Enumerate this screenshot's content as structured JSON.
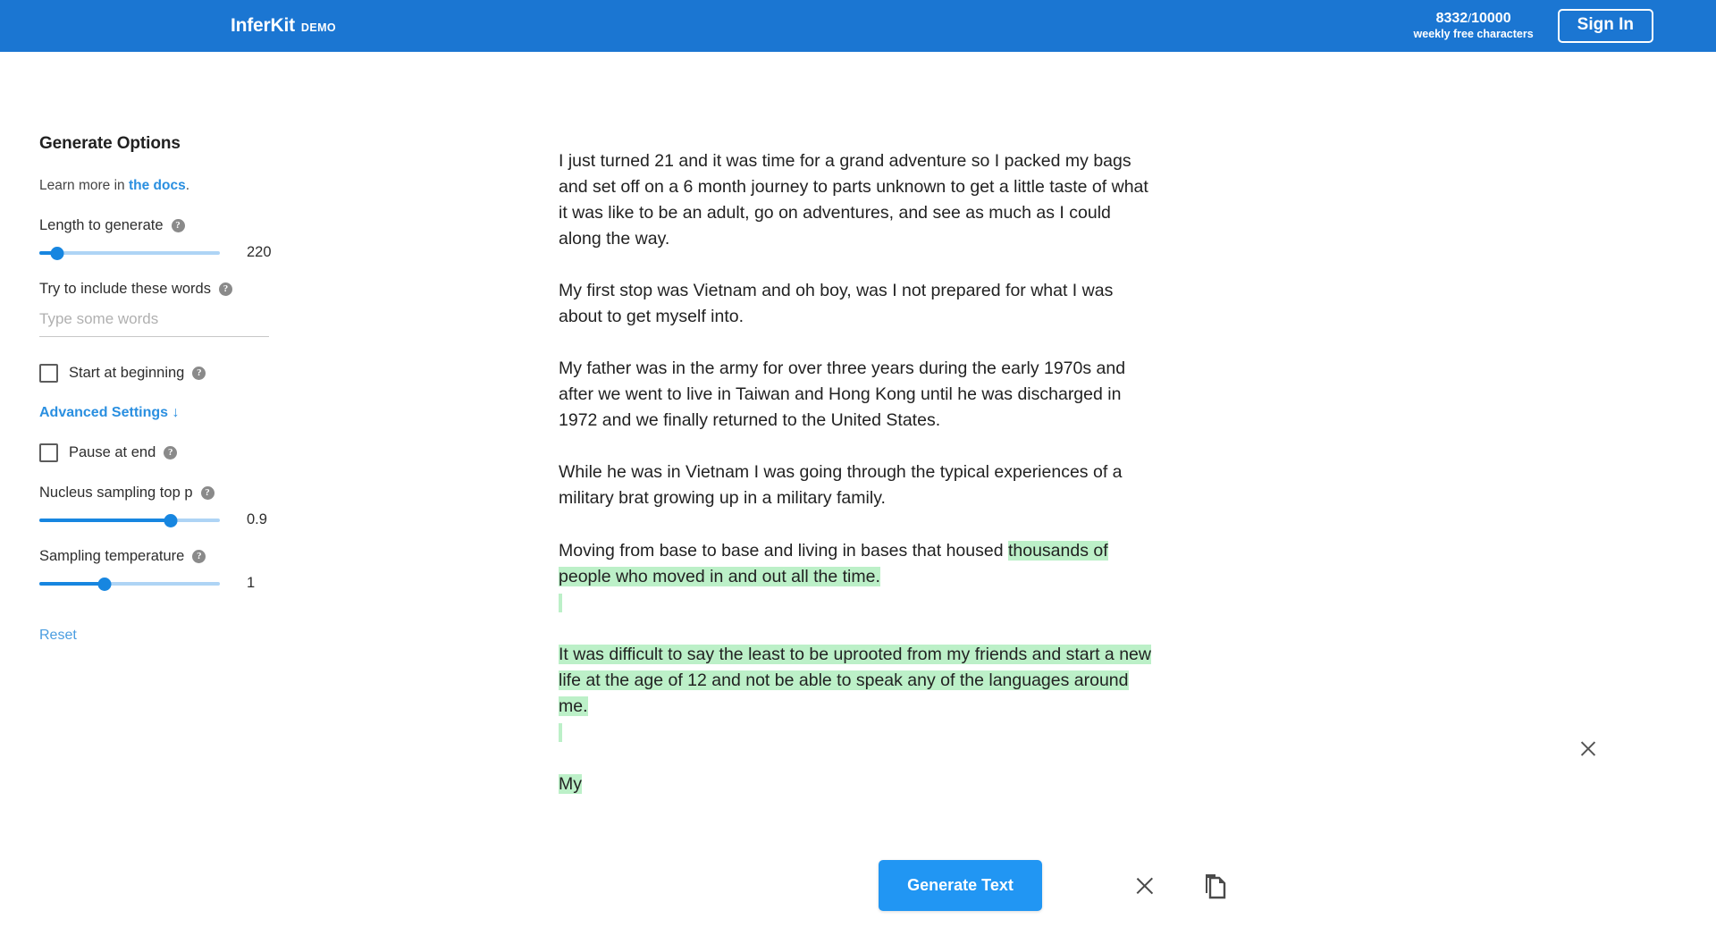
{
  "header": {
    "logo_main": "InferKit",
    "logo_sub": "DEMO",
    "quota_used": "8332",
    "quota_separator": "/",
    "quota_total": "10000",
    "quota_caption": "weekly free characters",
    "signin_label": "Sign In",
    "brand_color": "#1b76d2"
  },
  "sidebar": {
    "title": "Generate Options",
    "learn_more_prefix": "Learn more in ",
    "learn_more_link": "the docs",
    "learn_more_suffix": ".",
    "length": {
      "label": "Length to generate",
      "value": "220",
      "percent": 10
    },
    "include_words": {
      "label": "Try to include these words",
      "value": "",
      "placeholder": "Type some words"
    },
    "start_at_beginning": {
      "label": "Start at beginning",
      "checked": false
    },
    "advanced_settings": {
      "label": "Advanced Settings",
      "arrow": "↓"
    },
    "pause_at_end": {
      "label": "Pause at end",
      "checked": false
    },
    "top_p": {
      "label": "Nucleus sampling top p",
      "value": "0.9",
      "percent": 73
    },
    "temperature": {
      "label": "Sampling temperature",
      "value": "1",
      "percent": 36
    },
    "reset_label": "Reset",
    "help_glyph": "?",
    "accent_color": "#2a8fe0",
    "slider_color": "#1786e0"
  },
  "document": {
    "highlight_color": "#bcf0c8",
    "paragraphs": [
      {
        "text": "I just turned 21 and it was time for a grand adventure so I packed my bags and set off on a 6 month journey to parts unknown to get a little taste of what it was like to be an adult, go on adventures, and see as much as I could along the way.",
        "highlighted": false
      },
      {
        "text": "My first stop was Vietnam and oh boy, was I not prepared for what I was about to get myself into.",
        "highlighted": false
      },
      {
        "text": "My father was in the army for over three years during the early 1970s and after we went to live in Taiwan and Hong Kong until he was discharged in 1972 and we finally returned to the United States.",
        "highlighted": false
      },
      {
        "text": "While he was in Vietnam I was going through the typical experiences of a military brat growing up in a military family.",
        "highlighted": false
      },
      {
        "text_plain": "Moving from base to base and living in bases that housed ",
        "text_highlighted": "thousands of people who moved in and out all the time.",
        "highlighted": "partial"
      },
      {
        "text": "It was difficult to say the least to be uprooted from my friends and start a new life at the age of 12 and not be able to speak any of the languages around me.",
        "highlighted": true
      },
      {
        "text": "My",
        "highlighted": true
      }
    ],
    "dismiss_icon": "close-icon"
  },
  "bottom": {
    "generate_label": "Generate Text",
    "clear_icon": "close-icon",
    "copy_icon": "copy-icon",
    "generate_color": "#2196f3"
  }
}
